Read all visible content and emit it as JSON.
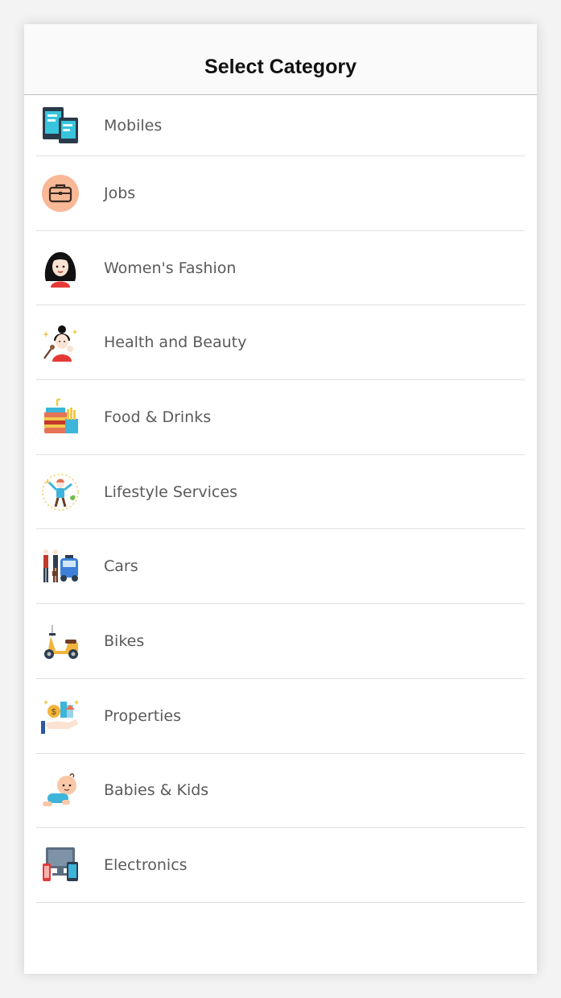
{
  "header": {
    "title": "Select Category"
  },
  "categories": [
    {
      "label": "Mobiles",
      "icon": "mobile-tablet-icon"
    },
    {
      "label": "Jobs",
      "icon": "briefcase-icon"
    },
    {
      "label": "Women's Fashion",
      "icon": "woman-avatar-icon"
    },
    {
      "label": "Health and Beauty",
      "icon": "beauty-woman-icon"
    },
    {
      "label": "Food & Drinks",
      "icon": "fastfood-icon"
    },
    {
      "label": "Lifestyle Services",
      "icon": "lifestyle-person-icon"
    },
    {
      "label": "Cars",
      "icon": "car-dealer-icon"
    },
    {
      "label": "Bikes",
      "icon": "scooter-icon"
    },
    {
      "label": "Properties",
      "icon": "property-money-icon"
    },
    {
      "label": "Babies & Kids",
      "icon": "baby-crawling-icon"
    },
    {
      "label": "Electronics",
      "icon": "electronics-devices-icon"
    }
  ],
  "colors": {
    "accent_orange": "#f9b896",
    "divider": "#e0e0e0"
  }
}
